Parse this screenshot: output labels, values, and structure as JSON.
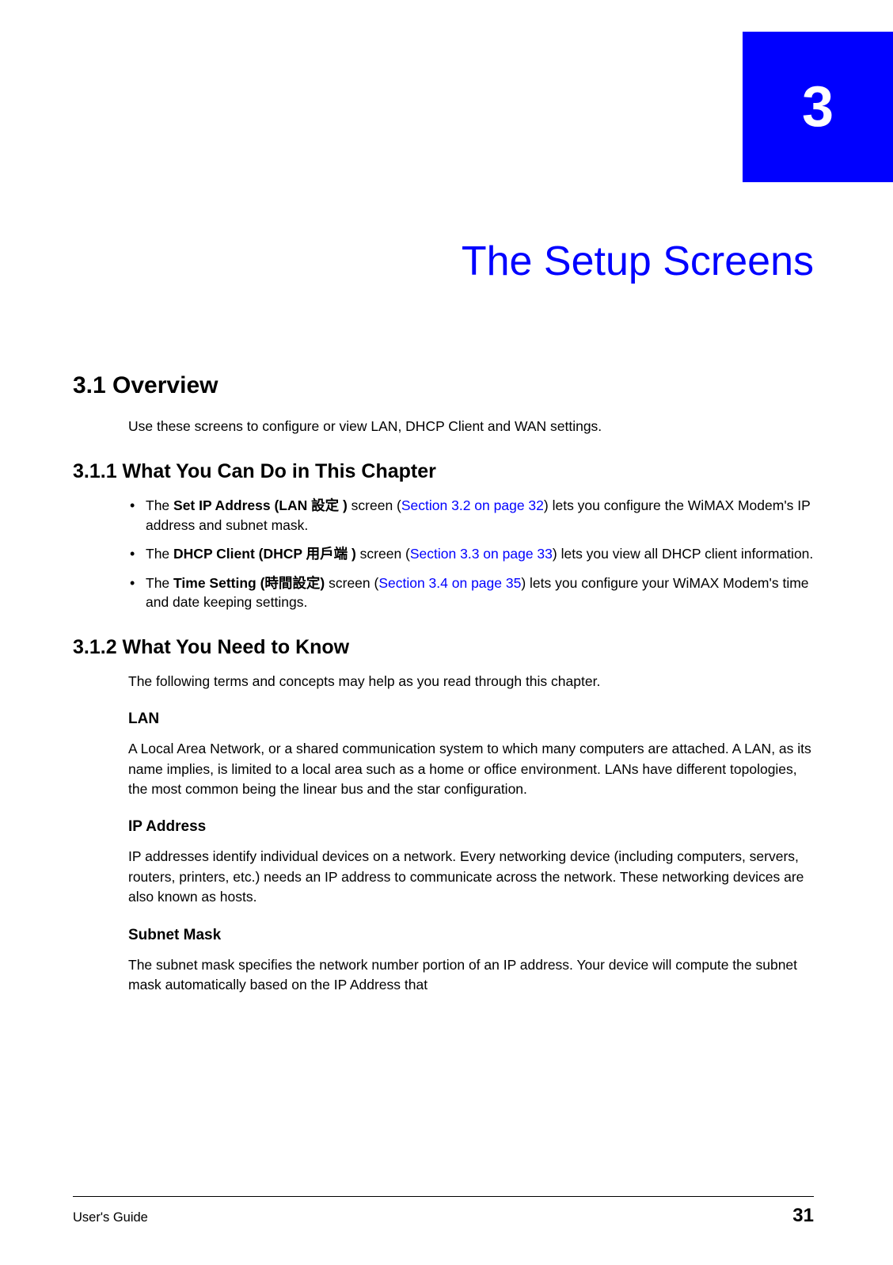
{
  "chapter": {
    "number": "3",
    "title": "The Setup Screens"
  },
  "secOverview": {
    "heading": "3.1  Overview",
    "intro": "Use these screens to configure or view LAN, DHCP Client and WAN settings."
  },
  "secWhatYouCanDo": {
    "heading": "3.1.1  What You Can Do in This Chapter",
    "items": [
      {
        "pre": "The ",
        "bold": "Set IP Address (LAN 設定 )",
        "mid": " screen (",
        "xref": "Section 3.2 on page 32",
        "post": ") lets you configure the WiMAX Modem's IP address and subnet mask."
      },
      {
        "pre": "The ",
        "bold": "DHCP Client (DHCP 用戶端 )",
        "mid": " screen (",
        "xref": "Section 3.3 on page 33",
        "post": ") lets you view all DHCP client information."
      },
      {
        "pre": "The ",
        "bold": "Time Setting (時間設定)",
        "mid": " screen (",
        "xref": "Section 3.4 on page 35",
        "post": ") lets you configure your WiMAX Modem's time and date keeping settings."
      }
    ]
  },
  "secNeedToKnow": {
    "heading": "3.1.2  What You Need to Know",
    "intro": "The following terms and concepts may help as you read through this chapter.",
    "terms": [
      {
        "head": "LAN",
        "body": "A Local Area Network, or a shared communication system to which many computers are attached. A LAN, as its name implies, is limited to a local area such as a home or office environment. LANs have different topologies, the most common being the linear bus and the star configuration."
      },
      {
        "head": "IP Address",
        "body": "IP addresses identify individual devices on a network. Every networking device (including computers, servers, routers, printers, etc.) needs an IP address to communicate across the network. These networking devices are also known as hosts."
      },
      {
        "head": "Subnet Mask",
        "body": "The subnet mask specifies the network number portion of an IP address. Your device will compute the subnet mask automatically based on the IP Address that"
      }
    ]
  },
  "footer": {
    "left": "User's Guide",
    "page": "31"
  }
}
